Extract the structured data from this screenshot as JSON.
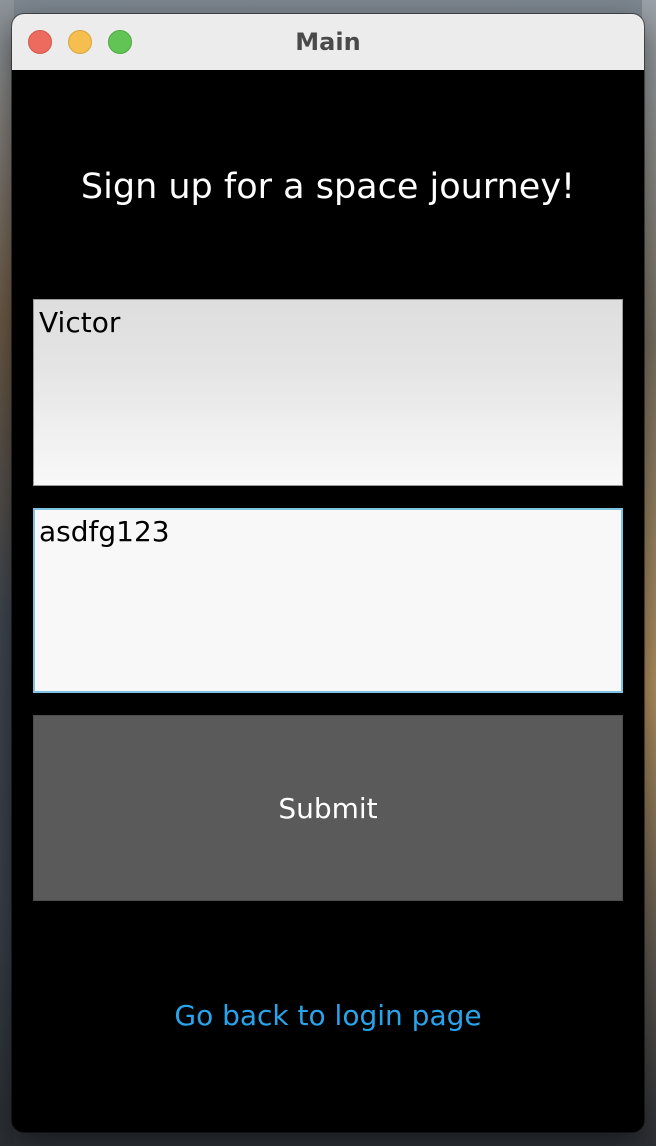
{
  "window": {
    "title": "Main"
  },
  "signup": {
    "heading": "Sign up for a space journey!",
    "name_value": "Victor",
    "password_value": "asdfg123",
    "submit_label": "Submit",
    "back_link": "Go back to login page"
  },
  "colors": {
    "background": "#000000",
    "link": "#29a3ea",
    "button": "#5a5a5a",
    "focus_border": "#7ec3e0"
  }
}
